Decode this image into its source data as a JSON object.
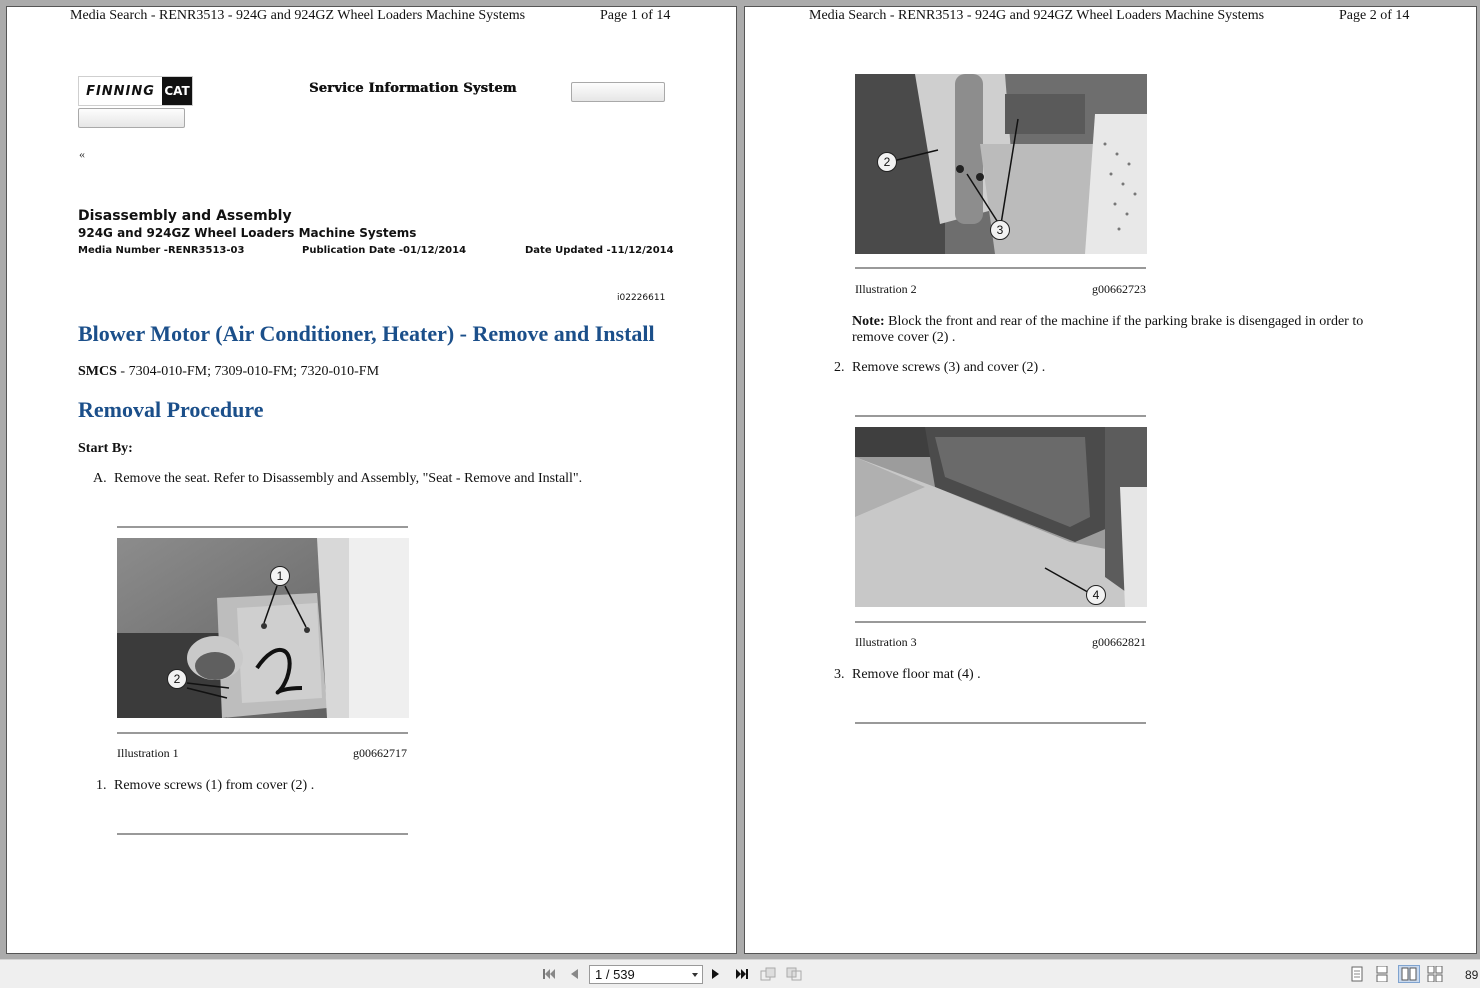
{
  "page1": {
    "header_left": "Media Search - RENR3513 - 924G and 924GZ Wheel Loaders Machine Systems",
    "header_right": "Page 1 of 14",
    "logo_text": "FINNING",
    "logo_cat": "CAT",
    "sis_title": "Service Information System",
    "back_link": "«",
    "doc_title": "Disassembly and Assembly",
    "doc_subtitle": "924G and 924GZ Wheel Loaders Machine Systems",
    "media_number": "Media Number -RENR3513-03",
    "publication_date": "Publication Date -01/12/2014",
    "date_updated": "Date Updated -11/12/2014",
    "info_id": "i02226611",
    "main_title": "Blower Motor (Air Conditioner, Heater) - Remove and Install",
    "smcs_label": "SMCS",
    "smcs_value": " - 7304-010-FM; 7309-010-FM; 7320-010-FM",
    "section_title": "Removal Procedure",
    "start_by": "Start By:",
    "step_a_marker": "A.",
    "step_a_text": "Remove the seat. Refer to Disassembly and Assembly, \"Seat - Remove and Install\".",
    "illustration1": {
      "label": "Illustration 1",
      "code": "g00662717",
      "callouts": [
        "1",
        "2"
      ]
    },
    "step1_marker": "1.",
    "step1_text": "Remove screws (1) from cover (2) ."
  },
  "page2": {
    "header_left": "Media Search - RENR3513 - 924G and 924GZ Wheel Loaders Machine Systems",
    "header_right": "Page 2 of 14",
    "illustration2": {
      "label": "Illustration 2",
      "code": "g00662723",
      "callouts": [
        "2",
        "3"
      ]
    },
    "note_label": "Note:",
    "note_line1": " Block the front and rear of the machine if the parking brake is disengaged in order to",
    "note_line2": "remove cover (2) .",
    "step2_marker": "2.",
    "step2_text": "Remove screws (3) and cover (2) .",
    "illustration3": {
      "label": "Illustration 3",
      "code": "g00662821",
      "callouts": [
        "4"
      ]
    },
    "step3_marker": "3.",
    "step3_text": "Remove floor mat (4) ."
  },
  "toolbar": {
    "page_indicator": "1 / 539",
    "zoom": "89",
    "icons": [
      "first-page-icon",
      "previous-page-icon",
      "next-page-icon",
      "last-page-icon",
      "back-view-icon",
      "forward-view-icon",
      "single-page-icon",
      "continuous-icon",
      "facing-icon",
      "continuous-facing-icon"
    ]
  }
}
